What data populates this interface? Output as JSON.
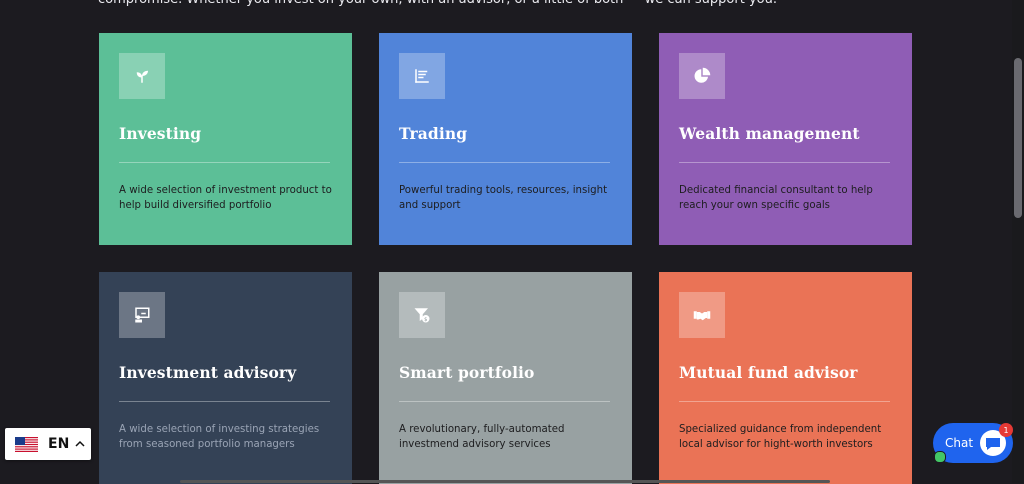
{
  "intro": {
    "text": "compromise. Whether you invest on your own, with an advisor, or a little of both — we can support you."
  },
  "cards": [
    {
      "title": "Investing",
      "description": "A wide selection of investment product to help build diversified portfolio",
      "color": "#5cbf97",
      "icon": "sprout-icon"
    },
    {
      "title": "Trading",
      "description": "Powerful trading tools, resources, insight and support",
      "color": "#5184d9",
      "icon": "bar-chart-icon"
    },
    {
      "title": "Wealth management",
      "description": "Dedicated financial consultant to help reach your own specific goals",
      "color": "#8f5db5",
      "icon": "pie-chart-icon"
    },
    {
      "title": "Investment advisory",
      "description": "A wide selection of investing strategies from seasoned portfolio managers",
      "color": "#344256",
      "icon": "presentation-icon"
    },
    {
      "title": "Smart portfolio",
      "description": "A revolutionary, fully-automated investmend advisory services",
      "color": "#98a1a2",
      "icon": "funnel-dollar-icon"
    },
    {
      "title": "Mutual fund advisor",
      "description": "Specialized guidance from independent local advisor for hight-worth investors",
      "color": "#ea7356",
      "icon": "handshake-icon"
    }
  ],
  "language": {
    "code": "EN"
  },
  "chat": {
    "label": "Chat",
    "badge": "1"
  }
}
